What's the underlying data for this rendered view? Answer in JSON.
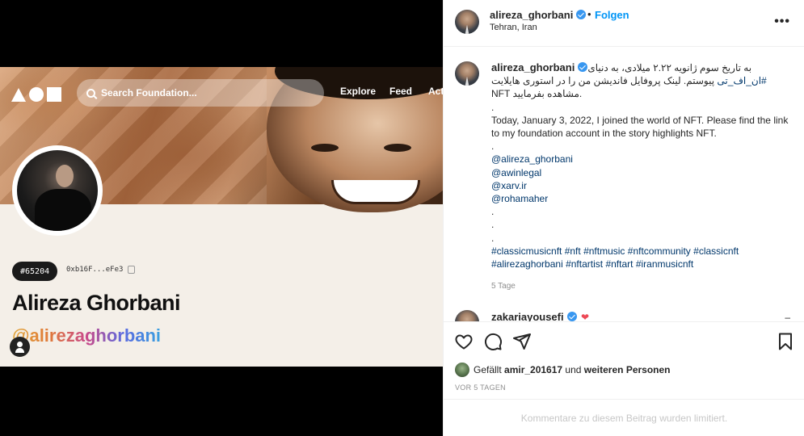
{
  "post_image": {
    "search_placeholder": "Search Foundation...",
    "nav": [
      "Explore",
      "Feed",
      "Act"
    ],
    "token_badge": "#65204",
    "wallet": "0xb16F...eFe3",
    "profile_name": "Alireza Ghorbani",
    "profile_handle": "@alirezaghorbani"
  },
  "header": {
    "username": "alireza_ghorbani",
    "separator": "•",
    "follow_label": "Folgen",
    "location": "Tehran, Iran",
    "more_label": "•••"
  },
  "caption": {
    "username": "alireza_ghorbani",
    "fa_line1": "به تاریخ سوم ژانویه ۲.۲۲ میلادی، به دنیای",
    "fa_line2_tag": "#ان_اف_تی",
    "fa_line2_text": " پیوستم. لینک پروفایل فاندیشن من را در استوری هایلایت",
    "fa_line3": "NFT مشاهده بفرمایید.",
    "dot1": ".",
    "en_text": "Today, January 3, 2022, I joined the world of NFT. Please find the link to my foundation account in the story highlights NFT.",
    "dot2": ".",
    "mentions": [
      "@alireza_ghorbani",
      "@awinlegal",
      "@xarv.ir",
      "@rohamaher"
    ],
    "dot3": ".",
    "dot4": ".",
    "dot5": ".",
    "hashtags_line1": [
      "#classicmusicnft",
      "#nft",
      "#nftmusic",
      "#nftcommunity",
      "#classicnft"
    ],
    "hashtags_line2": [
      "#alirezaghorbani",
      "#nftartist",
      "#nftart",
      "#iranmusicnft"
    ],
    "age": "5 Tage"
  },
  "comment2": {
    "username": "zakariayousefi",
    "heart": "❤",
    "more": "–"
  },
  "likes": {
    "prefix": "Gefällt ",
    "user": "amir_201617",
    "middle": " und ",
    "others": "weiteren Personen"
  },
  "timestamp": "VOR 5 TAGEN",
  "comments_limited": "Kommentare zu diesem Beitrag wurden limitiert.",
  "colors": {
    "link": "#00376b",
    "follow": "#0095f6",
    "verified": "#3897f0",
    "muted": "#8e8e8e"
  }
}
